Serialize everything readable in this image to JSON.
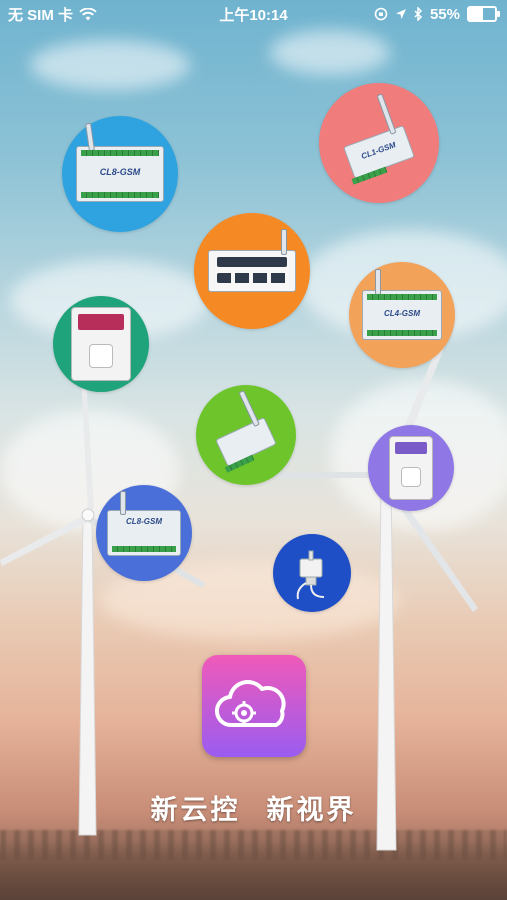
{
  "status_bar": {
    "carrier": "无 SIM 卡",
    "wifi_icon": "wifi-icon",
    "time": "上午10:14",
    "orientation_lock_icon": "orientation-lock-icon",
    "location_icon": "location-arrow-icon",
    "bluetooth_icon": "bluetooth-icon",
    "battery_percent": "55%",
    "battery_level": 0.55
  },
  "devices": [
    {
      "name": "CL8-GSM relay controller",
      "label": "CL8-GSM",
      "color": "#2ea3e0",
      "kind": "controller-8"
    },
    {
      "name": "GSM relay module",
      "label": "CL1-GSM",
      "color": "#f07c7c",
      "kind": "small-relay"
    },
    {
      "name": "Power strip",
      "label": "",
      "color": "#f58a25",
      "kind": "power-strip"
    },
    {
      "name": "CL4-GSM relay controller",
      "label": "CL4-GSM",
      "color": "#f2a259",
      "kind": "controller-4"
    },
    {
      "name": "Smart socket",
      "label": "",
      "color": "#1ea37a",
      "kind": "socket"
    },
    {
      "name": "GSM relay small green",
      "label": "",
      "color": "#6ec52b",
      "kind": "small-relay"
    },
    {
      "name": "Smart socket white",
      "label": "",
      "color": "#8f78e6",
      "kind": "socket"
    },
    {
      "name": "CL8-GSM controller blue",
      "label": "CL8-GSM",
      "color": "#4b6fd9",
      "kind": "controller-8"
    },
    {
      "name": "Water valve sensor",
      "label": "",
      "color": "#1f4fc7",
      "kind": "valve"
    }
  ],
  "app": {
    "icon": "cloud-gear-icon",
    "gradient_top": "#f05ab9",
    "gradient_bottom": "#9a5cf0"
  },
  "slogan": {
    "part1": "新云控",
    "part2": "新视界"
  }
}
